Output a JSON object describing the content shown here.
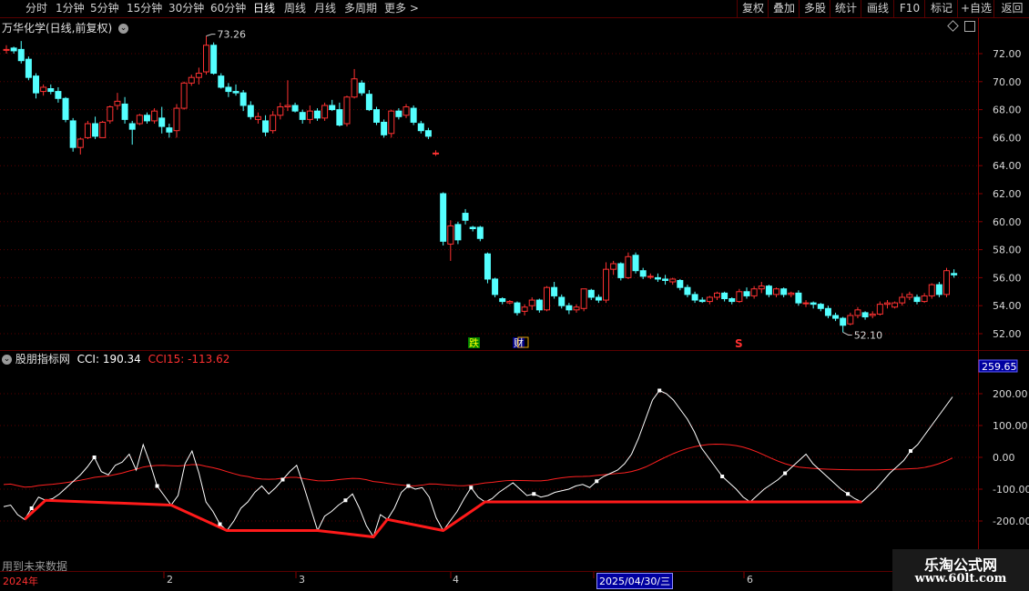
{
  "toolbar": {
    "periods": [
      "分时",
      "1分钟",
      "5分钟",
      "15分钟",
      "30分钟",
      "60分钟",
      "日线",
      "周线",
      "月线",
      "多周期",
      "更多 >"
    ],
    "active_period": "日线",
    "right_buttons": [
      "复权",
      "叠加",
      "多股",
      "统计",
      "画线",
      "F10",
      "标记",
      "+自选",
      "返回"
    ]
  },
  "price_panel": {
    "title": "万华化学(日线,前复权)",
    "high_label": "73.26",
    "low_label": "52.10",
    "y_ticks": [
      "72.00",
      "70.00",
      "68.00",
      "66.00",
      "64.00",
      "62.00",
      "60.00",
      "58.00",
      "56.00",
      "54.00",
      "52.00"
    ],
    "markers": {
      "drop": "跌",
      "finance": "财",
      "s": "S"
    }
  },
  "indicator_panel": {
    "title": "股朋指标网",
    "cci_label": "CCI: 190.34",
    "cci15_label": "CCI15: -113.62",
    "y_max_label": "259.65",
    "y_ticks": [
      "200.00",
      "100.00",
      "0.00",
      "-100.00",
      "-200.00"
    ],
    "future_note": "用到未来数据"
  },
  "date_axis": {
    "labels": [
      "2024年",
      "2",
      "3",
      "4",
      "6"
    ],
    "cursor_date": "2025/04/30/三"
  },
  "watermark": {
    "line1": "乐淘公式网",
    "line2": "www.60lt.com"
  },
  "colors": {
    "up": "#ff3232",
    "down": "#54ffff",
    "grid": "#5a0000",
    "cci": "#ffffff",
    "cci15": "#ff2020",
    "zigzag": "#ff1a1a"
  },
  "chart_data": [
    {
      "type": "candlestick",
      "title": "万华化学(日线,前复权)",
      "ylim": [
        51.5,
        73.0
      ],
      "annotations": {
        "high": 73.26,
        "low": 52.1
      },
      "candles": [
        [
          72.3,
          72.6,
          72.0,
          72.3
        ],
        [
          72.4,
          72.5,
          72.0,
          72.2
        ],
        [
          72.3,
          72.9,
          71.3,
          71.5
        ],
        [
          71.6,
          71.8,
          70.1,
          70.3
        ],
        [
          70.4,
          70.6,
          68.8,
          69.2
        ],
        [
          69.3,
          69.8,
          69.0,
          69.6
        ],
        [
          69.5,
          69.8,
          69.1,
          69.3
        ],
        [
          69.3,
          69.6,
          68.5,
          68.8
        ],
        [
          68.8,
          68.9,
          67.1,
          67.3
        ],
        [
          67.2,
          67.4,
          65.0,
          65.3
        ],
        [
          65.3,
          66.0,
          64.8,
          65.9
        ],
        [
          66.0,
          67.2,
          65.9,
          67.0
        ],
        [
          67.0,
          67.5,
          65.9,
          66.1
        ],
        [
          66.0,
          67.2,
          66.0,
          67.1
        ],
        [
          67.2,
          68.3,
          67.0,
          68.2
        ],
        [
          68.3,
          69.2,
          68.0,
          68.6
        ],
        [
          68.4,
          68.9,
          67.0,
          67.3
        ],
        [
          67.0,
          67.2,
          65.5,
          66.6
        ],
        [
          67.0,
          67.7,
          66.9,
          67.6
        ],
        [
          67.6,
          67.8,
          67.0,
          67.2
        ],
        [
          67.2,
          68.1,
          67.0,
          67.9
        ],
        [
          67.4,
          68.2,
          66.3,
          66.8
        ],
        [
          66.7,
          67.0,
          66.0,
          66.4
        ],
        [
          66.5,
          68.4,
          66.0,
          68.1
        ],
        [
          68.1,
          70.0,
          68.0,
          69.9
        ],
        [
          69.9,
          70.5,
          69.7,
          70.3
        ],
        [
          70.3,
          71.0,
          69.8,
          70.6
        ],
        [
          70.7,
          73.26,
          70.5,
          72.6
        ],
        [
          72.6,
          72.8,
          70.5,
          70.6
        ],
        [
          70.4,
          70.6,
          69.5,
          69.6
        ],
        [
          69.6,
          69.9,
          68.9,
          69.3
        ],
        [
          69.3,
          69.8,
          69.0,
          69.2
        ],
        [
          69.2,
          69.4,
          67.9,
          68.3
        ],
        [
          68.3,
          68.6,
          67.3,
          67.5
        ],
        [
          67.3,
          67.8,
          67.0,
          67.5
        ],
        [
          67.2,
          67.6,
          66.1,
          66.4
        ],
        [
          66.5,
          67.9,
          66.3,
          67.6
        ],
        [
          67.6,
          68.5,
          67.3,
          68.2
        ],
        [
          68.2,
          70.1,
          67.9,
          68.3
        ],
        [
          68.3,
          68.5,
          67.8,
          67.9
        ],
        [
          67.8,
          68.0,
          67.0,
          67.3
        ],
        [
          67.3,
          68.3,
          67.0,
          67.9
        ],
        [
          67.9,
          68.1,
          67.2,
          67.4
        ],
        [
          67.4,
          68.5,
          67.2,
          68.3
        ],
        [
          68.3,
          68.7,
          67.9,
          68.0
        ],
        [
          68.0,
          68.5,
          66.8,
          66.9
        ],
        [
          67.0,
          69.0,
          66.8,
          68.9
        ],
        [
          68.9,
          70.9,
          68.8,
          70.2
        ],
        [
          69.9,
          70.1,
          69.0,
          69.2
        ],
        [
          69.1,
          69.4,
          67.9,
          68.0
        ],
        [
          68.0,
          68.2,
          66.9,
          67.1
        ],
        [
          67.1,
          67.3,
          66.0,
          66.2
        ],
        [
          66.3,
          68.0,
          66.0,
          67.9
        ],
        [
          67.9,
          68.1,
          67.3,
          67.5
        ],
        [
          67.6,
          68.4,
          67.4,
          68.2
        ],
        [
          68.1,
          68.3,
          66.9,
          67.1
        ],
        [
          67.0,
          67.2,
          66.3,
          66.5
        ],
        [
          66.5,
          66.7,
          65.9,
          66.1
        ],
        [
          64.9,
          65.1,
          64.7,
          64.9
        ],
        [
          62.0,
          62.1,
          58.3,
          58.6
        ],
        [
          58.4,
          60.1,
          57.2,
          59.7
        ],
        [
          59.8,
          60.0,
          58.4,
          58.7
        ],
        [
          60.6,
          60.9,
          59.8,
          60.1
        ],
        [
          59.6,
          59.7,
          59.3,
          59.5
        ],
        [
          59.6,
          59.7,
          58.6,
          58.8
        ],
        [
          57.7,
          57.8,
          55.6,
          55.9
        ],
        [
          55.9,
          56.0,
          54.6,
          54.8
        ],
        [
          54.5,
          54.6,
          54.1,
          54.3
        ],
        [
          54.2,
          54.4,
          54.1,
          54.3
        ],
        [
          54.2,
          54.3,
          53.3,
          53.5
        ],
        [
          53.6,
          54.1,
          53.3,
          53.9
        ],
        [
          54.0,
          54.6,
          53.7,
          54.4
        ],
        [
          54.4,
          54.5,
          53.5,
          53.7
        ],
        [
          53.7,
          55.4,
          53.6,
          55.3
        ],
        [
          55.3,
          55.7,
          54.5,
          54.7
        ],
        [
          54.6,
          54.8,
          53.8,
          54.0
        ],
        [
          54.0,
          54.2,
          53.4,
          53.7
        ],
        [
          53.7,
          54.1,
          53.5,
          53.9
        ],
        [
          53.8,
          55.2,
          53.6,
          55.2
        ],
        [
          55.1,
          55.2,
          54.4,
          54.6
        ],
        [
          54.6,
          54.8,
          54.2,
          54.4
        ],
        [
          54.4,
          57.1,
          54.2,
          56.6
        ],
        [
          56.6,
          57.2,
          56.2,
          57.0
        ],
        [
          57.0,
          57.1,
          55.8,
          56.0
        ],
        [
          56.0,
          57.8,
          55.9,
          57.5
        ],
        [
          57.6,
          57.8,
          56.3,
          56.5
        ],
        [
          56.5,
          56.7,
          55.9,
          56.1
        ],
        [
          56.1,
          56.3,
          55.9,
          56.1
        ],
        [
          56.0,
          56.3,
          55.7,
          55.9
        ],
        [
          55.9,
          56.2,
          55.5,
          55.8
        ],
        [
          55.7,
          56.0,
          55.5,
          55.9
        ],
        [
          55.8,
          55.9,
          55.1,
          55.3
        ],
        [
          55.3,
          55.5,
          54.6,
          54.8
        ],
        [
          54.8,
          55.0,
          54.2,
          54.4
        ],
        [
          54.4,
          54.6,
          54.2,
          54.3
        ],
        [
          54.3,
          54.7,
          54.1,
          54.6
        ],
        [
          54.6,
          55.0,
          54.4,
          54.9
        ],
        [
          54.9,
          55.0,
          54.3,
          54.5
        ],
        [
          54.5,
          54.6,
          54.1,
          54.3
        ],
        [
          54.3,
          55.2,
          54.2,
          55.0
        ],
        [
          55.0,
          55.3,
          54.5,
          54.7
        ],
        [
          54.7,
          55.4,
          54.5,
          55.2
        ],
        [
          55.2,
          55.7,
          54.9,
          55.4
        ],
        [
          55.4,
          55.5,
          54.6,
          54.8
        ],
        [
          54.8,
          55.3,
          54.6,
          55.2
        ],
        [
          55.2,
          55.3,
          54.6,
          54.8
        ],
        [
          54.8,
          55.0,
          54.6,
          54.9
        ],
        [
          54.9,
          55.1,
          54.0,
          54.2
        ],
        [
          54.2,
          54.4,
          53.9,
          54.2
        ],
        [
          54.2,
          54.3,
          53.8,
          54.1
        ],
        [
          54.1,
          54.2,
          53.6,
          53.8
        ],
        [
          53.8,
          54.0,
          53.1,
          53.3
        ],
        [
          53.3,
          53.5,
          52.9,
          53.1
        ],
        [
          53.1,
          53.2,
          52.1,
          52.6
        ],
        [
          52.7,
          53.5,
          52.6,
          53.3
        ],
        [
          53.3,
          53.9,
          53.1,
          53.7
        ],
        [
          53.5,
          53.6,
          53.0,
          53.2
        ],
        [
          53.3,
          53.6,
          53.1,
          53.4
        ],
        [
          53.4,
          54.3,
          53.3,
          54.1
        ],
        [
          54.1,
          54.4,
          53.8,
          54.2
        ],
        [
          53.9,
          54.3,
          53.8,
          54.2
        ],
        [
          54.2,
          54.9,
          54.0,
          54.6
        ],
        [
          54.6,
          55.0,
          54.4,
          54.8
        ],
        [
          54.6,
          54.8,
          54.1,
          54.3
        ],
        [
          54.3,
          54.9,
          54.2,
          54.7
        ],
        [
          54.7,
          55.6,
          54.5,
          55.5
        ],
        [
          55.5,
          55.7,
          54.6,
          54.8
        ],
        [
          54.8,
          56.7,
          54.6,
          56.5
        ],
        [
          56.3,
          56.6,
          56.0,
          56.2
        ]
      ]
    },
    {
      "type": "line",
      "title": "股朋指标网",
      "ylim": [
        -250,
        260
      ],
      "series": [
        {
          "name": "CCI",
          "values": [
            -155,
            -150,
            -180,
            -195,
            -160,
            -125,
            -135,
            -130,
            -115,
            -95,
            -75,
            -55,
            -30,
            0,
            -45,
            -55,
            -25,
            -15,
            10,
            -40,
            40,
            -20,
            -90,
            -120,
            -150,
            -120,
            -20,
            20,
            -50,
            -140,
            -170,
            -210,
            -230,
            -200,
            -160,
            -140,
            -110,
            -90,
            -115,
            -95,
            -70,
            -45,
            -25,
            -90,
            -160,
            -230,
            -185,
            -170,
            -150,
            -135,
            -115,
            -160,
            -215,
            -250,
            -180,
            -195,
            -160,
            -110,
            -90,
            -100,
            -95,
            -125,
            -190,
            -230,
            -200,
            -170,
            -130,
            -95,
            -125,
            -140,
            -130,
            -110,
            -95,
            -80,
            -100,
            -120,
            -115,
            -125,
            -120,
            -110,
            -105,
            -100,
            -90,
            -85,
            -95,
            -75,
            -60,
            -50,
            -40,
            -20,
            10,
            60,
            120,
            180,
            210,
            200,
            180,
            150,
            120,
            80,
            30,
            0,
            -30,
            -60,
            -80,
            -100,
            -125,
            -140,
            -120,
            -100,
            -85,
            -70,
            -50,
            -30,
            -10,
            10,
            -20,
            -40,
            -60,
            -80,
            -100,
            -115,
            -130,
            -140,
            -120,
            -100,
            -75,
            -50,
            -30,
            -10,
            20,
            40,
            70,
            100,
            130,
            160,
            190
          ]
        }
      ]
    }
  ]
}
